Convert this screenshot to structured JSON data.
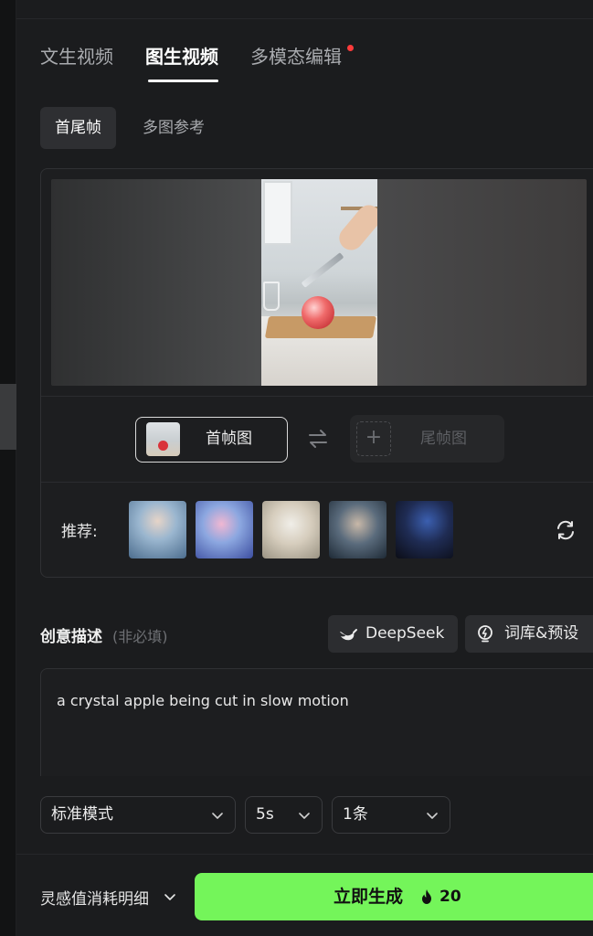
{
  "main_tabs": [
    {
      "label": "文生视频"
    },
    {
      "label": "图生视频"
    },
    {
      "label": "多模态编辑"
    }
  ],
  "active_main_tab": "图生视频",
  "sub_tabs": [
    {
      "label": "首尾帧"
    },
    {
      "label": "多图参考"
    }
  ],
  "active_sub_tab": "首尾帧",
  "frames": {
    "first_label": "首帧图",
    "last_label": "尾帧图",
    "plus": "+"
  },
  "recommend": {
    "label": "推荐:"
  },
  "description": {
    "title": "创意描述",
    "hint": "(非必填)",
    "deepseek_label": "DeepSeek",
    "library_label": "词库&预设",
    "prompt": "a crystal apple being cut in slow motion"
  },
  "options": {
    "mode": "标准模式",
    "duration": "5s",
    "count": "1条"
  },
  "footer": {
    "cost_link": "灵感值消耗明细",
    "generate_label": "立即生成",
    "generate_cost": "20"
  },
  "colors": {
    "accent": "#74f55a",
    "background": "#1b1c1e",
    "notification_dot": "#ff3b3b"
  }
}
